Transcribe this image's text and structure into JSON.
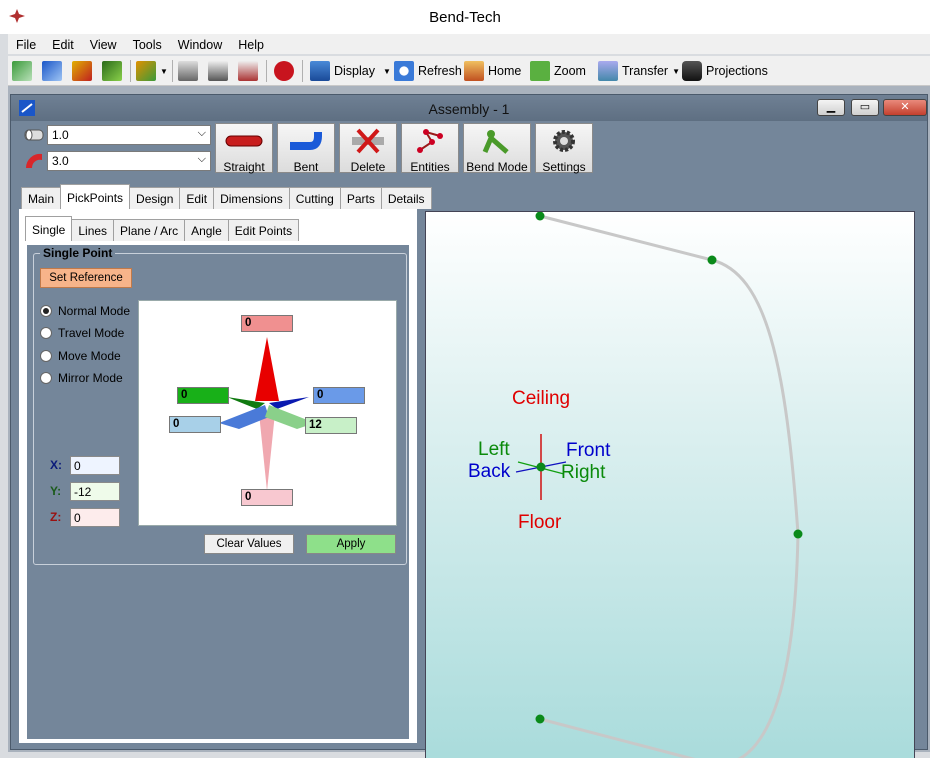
{
  "window": {
    "title": "Bend-Tech"
  },
  "menu": [
    "File",
    "Edit",
    "View",
    "Tools",
    "Window",
    "Help"
  ],
  "toolbar": {
    "display": "Display",
    "refresh": "Refresh",
    "home": "Home",
    "zoom": "Zoom",
    "transfer": "Transfer",
    "projections": "Projections"
  },
  "child": {
    "title": "Assembly - 1"
  },
  "combos": {
    "diameter": "1.0",
    "radius": "3.0"
  },
  "buttons": {
    "straight": "Straight",
    "bent": "Bent",
    "delete": "Delete",
    "entities": "Entities",
    "bend_mode": "Bend Mode",
    "settings": "Settings"
  },
  "main_tabs": [
    "Main",
    "PickPoints",
    "Design",
    "Edit",
    "Dimensions",
    "Cutting",
    "Parts",
    "Details"
  ],
  "sub_tabs": [
    "Single",
    "Lines",
    "Plane / Arc",
    "Angle",
    "Edit Points"
  ],
  "single_point": {
    "title": "Single Point",
    "set_reference": "Set Reference",
    "modes": [
      "Normal Mode",
      "Travel Mode",
      "Move Mode",
      "Mirror Mode"
    ],
    "selected_mode": "Normal Mode",
    "x_label": "X:",
    "y_label": "Y:",
    "z_label": "Z:",
    "x": "0",
    "y": "-12",
    "z": "0",
    "clear": "Clear Values",
    "apply": "Apply"
  },
  "widget": {
    "top": "0",
    "left": "0",
    "right": "0",
    "back_left": "0",
    "front_right": "12",
    "bottom": "0"
  },
  "viewport": {
    "ceiling": "Ceiling",
    "floor": "Floor",
    "left": "Left",
    "back": "Back",
    "front": "Front",
    "right": "Right"
  },
  "colors": {
    "panel": "#74869a",
    "apply": "#8ee08a",
    "set_reference": "#f7b48a",
    "ceiling": "#e00000",
    "left": "#0a8a0a",
    "front": "#0000cc"
  }
}
